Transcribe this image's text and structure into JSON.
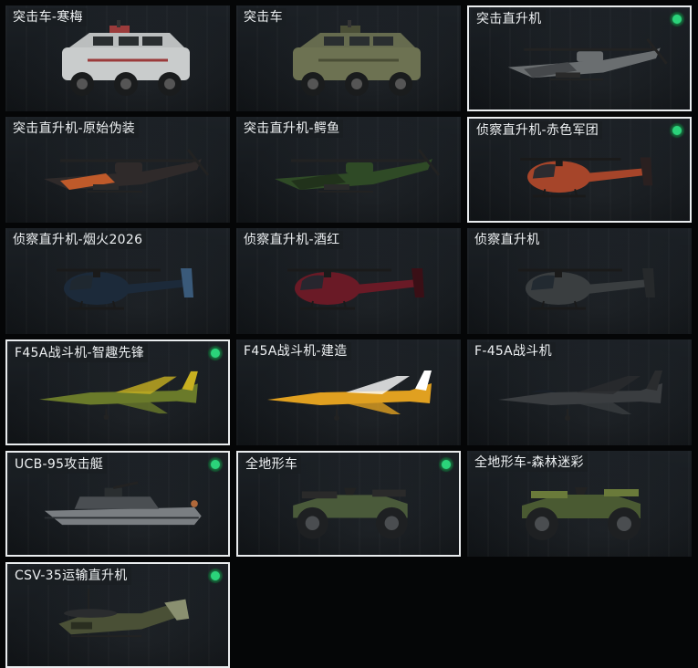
{
  "vehicles": [
    {
      "label": "突击车-寒梅",
      "selected": false,
      "equipped": false,
      "kind": "assault-vehicle",
      "color": "#c9cccc",
      "accent": "#9b3b3b"
    },
    {
      "label": "突击车",
      "selected": false,
      "equipped": false,
      "kind": "assault-vehicle",
      "color": "#6d7252",
      "accent": "#4a4e36"
    },
    {
      "label": "突击直升机",
      "selected": true,
      "equipped": true,
      "kind": "attack-helicopter",
      "color": "#6a6e70",
      "accent": "#3e4244"
    },
    {
      "label": "突击直升机-原始伪装",
      "selected": false,
      "equipped": false,
      "kind": "attack-helicopter",
      "color": "#2f2a2a",
      "accent": "#d8632a"
    },
    {
      "label": "突击直升机-鳄鱼",
      "selected": false,
      "equipped": false,
      "kind": "attack-helicopter",
      "color": "#2f4a26",
      "accent": "#1e2e1a"
    },
    {
      "label": "侦察直升机-赤色军团",
      "selected": true,
      "equipped": true,
      "kind": "scout-helicopter",
      "color": "#a6452a",
      "accent": "#2a2020"
    },
    {
      "label": "侦察直升机-烟火2026",
      "selected": false,
      "equipped": false,
      "kind": "scout-helicopter",
      "color": "#1c2a3a",
      "accent": "#3a5a7a"
    },
    {
      "label": "侦察直升机-酒红",
      "selected": false,
      "equipped": false,
      "kind": "scout-helicopter",
      "color": "#6a1a26",
      "accent": "#3a0f16"
    },
    {
      "label": "侦察直升机",
      "selected": false,
      "equipped": false,
      "kind": "scout-helicopter",
      "color": "#3a3e40",
      "accent": "#26292b"
    },
    {
      "label": "F45A战斗机-智趣先锋",
      "selected": true,
      "equipped": true,
      "kind": "fighter-jet",
      "color": "#6a7a2a",
      "accent": "#c8b020"
    },
    {
      "label": "F45A战斗机-建造",
      "selected": false,
      "equipped": false,
      "kind": "fighter-jet",
      "color": "#e0a020",
      "accent": "#ffffff"
    },
    {
      "label": "F-45A战斗机",
      "selected": false,
      "equipped": false,
      "kind": "fighter-jet",
      "color": "#3a3d40",
      "accent": "#2a2c2e"
    },
    {
      "label": "UCB-95攻击艇",
      "selected": true,
      "equipped": true,
      "kind": "attack-boat",
      "color": "#7a7e82",
      "accent": "#4a4e52"
    },
    {
      "label": "全地形车",
      "selected": true,
      "equipped": true,
      "kind": "atv",
      "color": "#4a5a3a",
      "accent": "#2a2a2a"
    },
    {
      "label": "全地形车-森林迷彩",
      "selected": false,
      "equipped": false,
      "kind": "atv",
      "color": "#4a5a32",
      "accent": "#6a7a3a"
    },
    {
      "label": "CSV-35运输直升机",
      "selected": true,
      "equipped": true,
      "kind": "transport-helicopter",
      "color": "#4a5036",
      "accent": "#8a9070"
    }
  ]
}
